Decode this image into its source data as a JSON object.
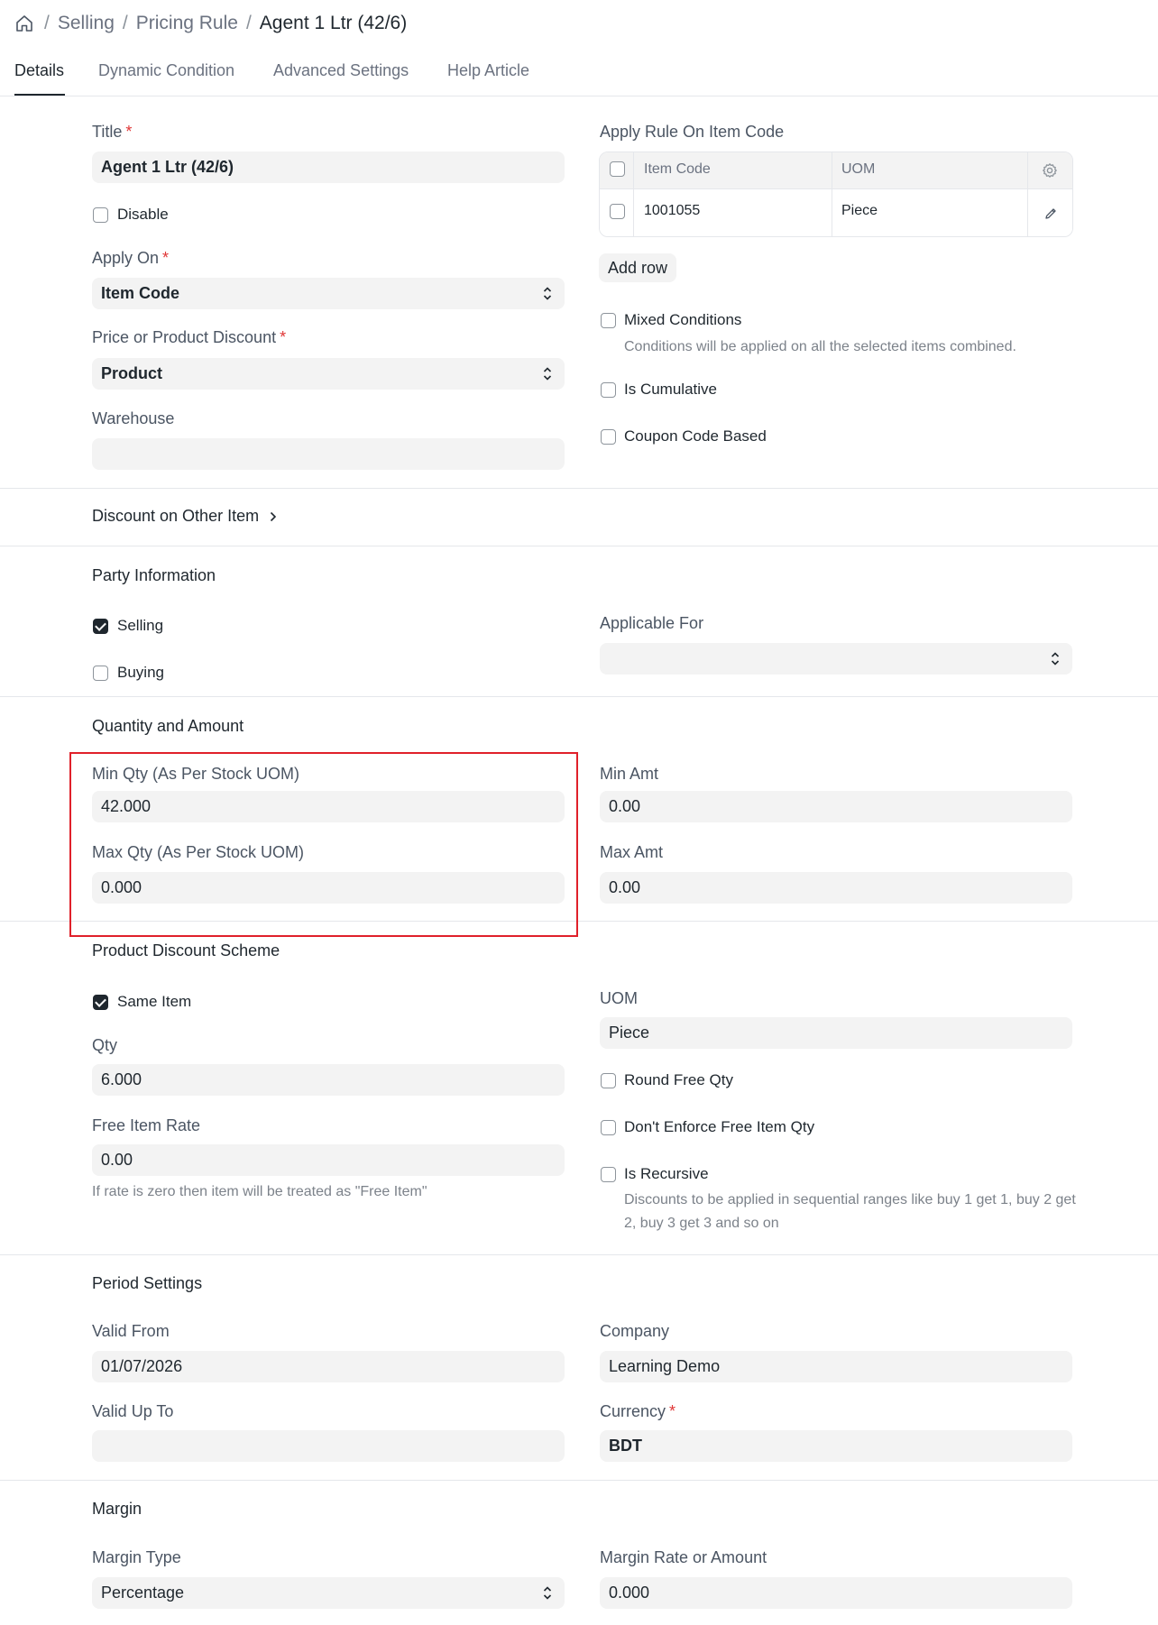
{
  "breadcrumb": {
    "items": [
      "Selling",
      "Pricing Rule"
    ],
    "current": "Agent 1 Ltr (42/6)"
  },
  "tabs": [
    "Details",
    "Dynamic Condition",
    "Advanced Settings",
    "Help Article"
  ],
  "details": {
    "title": {
      "label": "Title",
      "value": "Agent 1 Ltr (42/6)"
    },
    "disable": {
      "label": "Disable",
      "checked": false
    },
    "apply_on": {
      "label": "Apply On",
      "value": "Item Code"
    },
    "price_or_product_discount": {
      "label": "Price or Product Discount",
      "value": "Product"
    },
    "warehouse": {
      "label": "Warehouse",
      "value": ""
    },
    "apply_rule_on": {
      "label": "Apply Rule On Item Code",
      "columns": [
        "Item Code",
        "UOM"
      ],
      "rows": [
        {
          "item_code": "1001055",
          "uom": "Piece"
        }
      ],
      "add_row": "Add row"
    },
    "mixed_conditions": {
      "label": "Mixed Conditions",
      "help": "Conditions will be applied on all the selected items combined.",
      "checked": false
    },
    "is_cumulative": {
      "label": "Is Cumulative",
      "checked": false
    },
    "coupon_code_based": {
      "label": "Coupon Code Based",
      "checked": false
    }
  },
  "discount_other_item": {
    "title": "Discount on Other Item"
  },
  "party": {
    "title": "Party Information",
    "selling": {
      "label": "Selling",
      "checked": true
    },
    "buying": {
      "label": "Buying",
      "checked": false
    },
    "applicable_for": {
      "label": "Applicable For",
      "value": ""
    }
  },
  "quantity": {
    "title": "Quantity and Amount",
    "min_qty": {
      "label": "Min Qty (As Per Stock UOM)",
      "value": "42.000"
    },
    "max_qty": {
      "label": "Max Qty (As Per Stock UOM)",
      "value": "0.000"
    },
    "min_amt": {
      "label": "Min Amt",
      "value": "0.00"
    },
    "max_amt": {
      "label": "Max Amt",
      "value": "0.00"
    }
  },
  "product_discount": {
    "title": "Product Discount Scheme",
    "same_item": {
      "label": "Same Item",
      "checked": true
    },
    "qty": {
      "label": "Qty",
      "value": "6.000"
    },
    "free_item_rate": {
      "label": "Free Item Rate",
      "value": "0.00",
      "help": "If rate is zero then item will be treated as \"Free Item\""
    },
    "uom": {
      "label": "UOM",
      "value": "Piece"
    },
    "round_free_qty": {
      "label": "Round Free Qty",
      "checked": false
    },
    "dont_enforce": {
      "label": "Don't Enforce Free Item Qty",
      "checked": false
    },
    "is_recursive": {
      "label": "Is Recursive",
      "checked": false,
      "help": "Discounts to be applied in sequential ranges like buy 1 get 1, buy 2 get 2, buy 3 get 3 and so on"
    }
  },
  "period": {
    "title": "Period Settings",
    "valid_from": {
      "label": "Valid From",
      "value": "01/07/2026"
    },
    "valid_upto": {
      "label": "Valid Up To",
      "value": ""
    },
    "company": {
      "label": "Company",
      "value": "Learning Demo"
    },
    "currency": {
      "label": "Currency",
      "value": "BDT"
    }
  },
  "margin": {
    "title": "Margin",
    "margin_type": {
      "label": "Margin Type",
      "value": "Percentage"
    },
    "margin_rate": {
      "label": "Margin Rate or Amount",
      "value": "0.000"
    }
  },
  "colors": {
    "highlight": "#e0202a",
    "required": "#e03636",
    "field_bg": "#f3f3f3"
  }
}
